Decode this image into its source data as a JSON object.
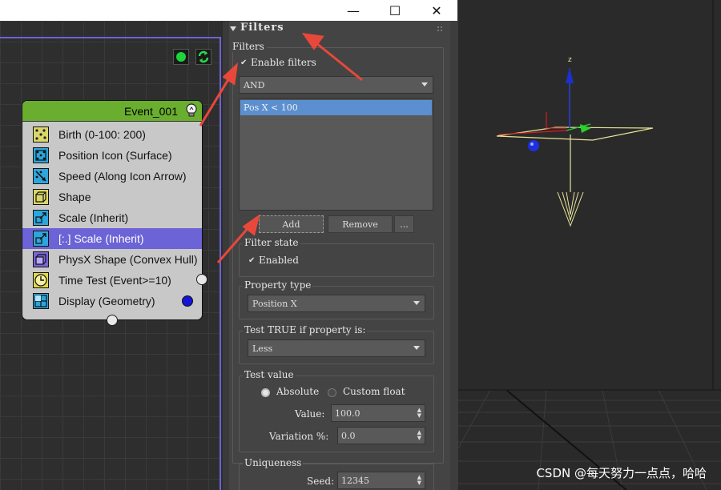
{
  "window": {
    "minimize": "—",
    "maximize": "☐",
    "close": "✕"
  },
  "event": {
    "title": "Event_001",
    "operators": [
      {
        "label": "Birth (0-100: 200)",
        "icon": "birth-icon"
      },
      {
        "label": "Position Icon (Surface)",
        "icon": "position-icon"
      },
      {
        "label": "Speed (Along Icon Arrow)",
        "icon": "speed-icon"
      },
      {
        "label": "Shape",
        "icon": "shape-icon"
      },
      {
        "label": "Scale (Inherit)",
        "icon": "scale-icon"
      },
      {
        "label": "[:.] Scale (Inherit)",
        "icon": "scale-icon",
        "selected": true
      },
      {
        "label": "PhysX Shape (Convex Hull)",
        "icon": "physx-icon"
      },
      {
        "label": "Time Test (Event>=10)",
        "icon": "clock-icon"
      },
      {
        "label": "Display (Geometry)",
        "icon": "display-icon"
      }
    ]
  },
  "panel": {
    "rollout_title": "Filters",
    "filters_group": "Filters",
    "enable_filters": "Enable filters",
    "logic_mode": "AND",
    "filter_list": [
      "Pos X < 100"
    ],
    "add_button": "Add",
    "remove_button": "Remove",
    "more_button": "...",
    "filter_state": {
      "group": "Filter state",
      "enabled": "Enabled"
    },
    "property_type": {
      "group": "Property type",
      "value": "Position X"
    },
    "test_true": {
      "group": "Test TRUE if property is:",
      "value": "Less"
    },
    "test_value": {
      "group": "Test value",
      "absolute": "Absolute",
      "custom_float": "Custom float",
      "value_label": "Value:",
      "value": "100.0",
      "variation_label": "Variation %:",
      "variation": "0.0"
    },
    "uniqueness": {
      "group": "Uniqueness",
      "seed_label": "Seed:",
      "seed": "12345"
    }
  },
  "viewport": {
    "axis_z": "z",
    "watermark": "CSDN @每天努力一点点，哈哈"
  },
  "colors": {
    "event_header": "#6aae2f",
    "selection": "#6b63d6",
    "annotation_arrow": "#e8483a"
  }
}
